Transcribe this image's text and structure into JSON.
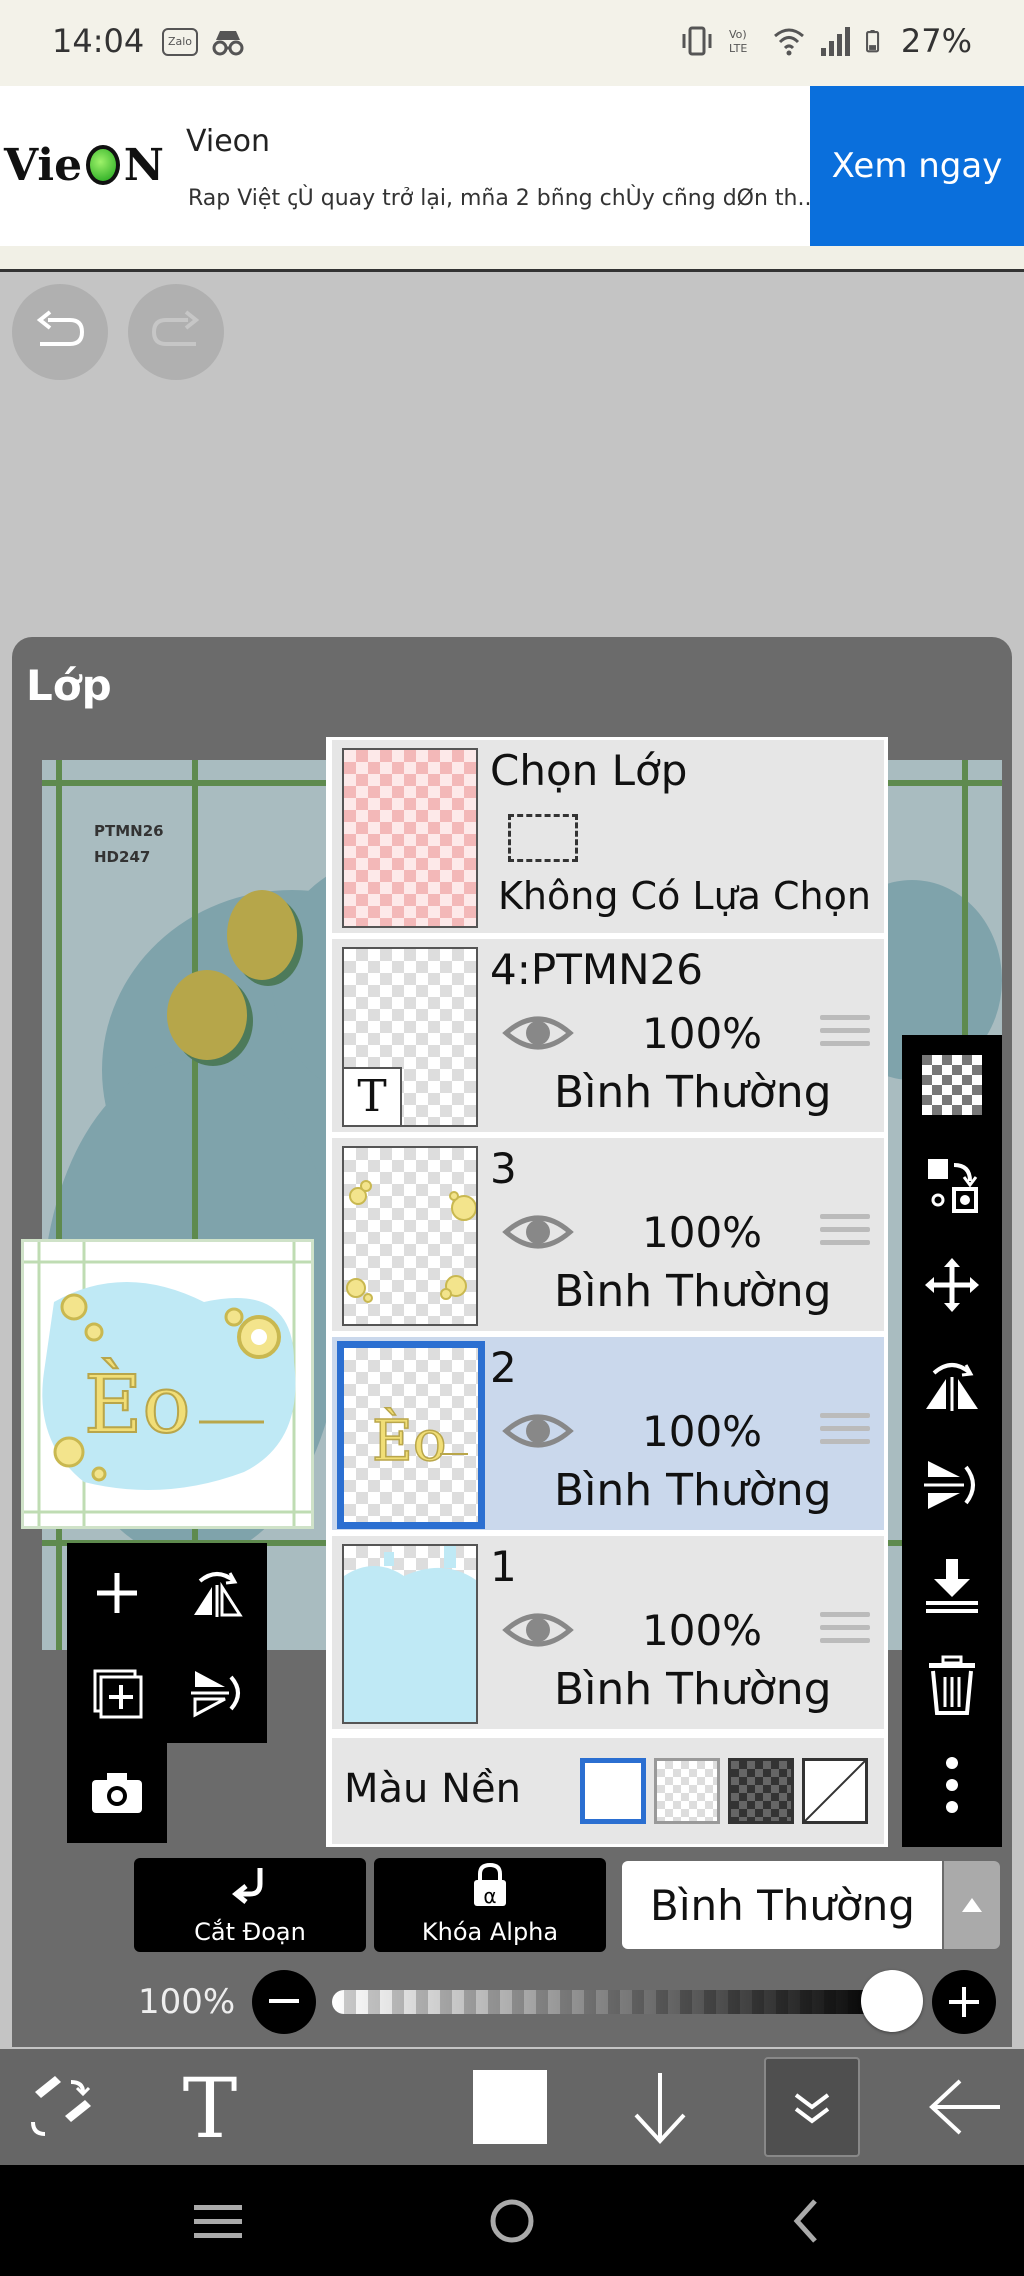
{
  "status_bar": {
    "time": "14:04",
    "app_icons": [
      "Zalo",
      "incognito-icon"
    ],
    "battery": "27%",
    "icons": [
      "vibrate-icon",
      "volte-icon",
      "wifi-icon",
      "signal-icon",
      "battery-icon"
    ]
  },
  "ad": {
    "logo_text_left": "Vie",
    "logo_text_right": "N",
    "title": "Vieon",
    "text": "Rap Việt ꞔÙ quay trở lại, mña 2 bñng chÙy cñng dØn th...",
    "button": "Xem ngay"
  },
  "canvas": {
    "undo_icon": "undo-icon",
    "redo_icon": "redo-icon",
    "bg_text_line1": "PTMN26",
    "bg_text_line2": "HD247"
  },
  "panel": {
    "title": "Lớp"
  },
  "layers": {
    "select_layer": {
      "name": "Chọn Lớp",
      "subtitle": "Không Có Lựa Chọn"
    },
    "items": [
      {
        "name": "4:PTMN26",
        "opacity": "100%",
        "blend": "Bình Thường",
        "is_text": true,
        "text_marker": "T",
        "selected": false
      },
      {
        "name": "3",
        "opacity": "100%",
        "blend": "Bình Thường",
        "selected": false
      },
      {
        "name": "2",
        "opacity": "100%",
        "blend": "Bình Thường",
        "selected": true
      },
      {
        "name": "1",
        "opacity": "100%",
        "blend": "Bình Thường",
        "selected": false
      }
    ],
    "background_label": "Màu Nền"
  },
  "actions": {
    "clipping_label": "Cắt Đoạn",
    "alpha_lock_label": "Khóa Alpha",
    "alpha_glyph": "α",
    "blend_mode": "Bình Thường",
    "opacity_label": "100%",
    "opacity_value": 1.0
  },
  "colors": {
    "accent": "#2b6fd1",
    "ad_button": "#0a6fdc",
    "selected_row": "#cad8ec"
  }
}
